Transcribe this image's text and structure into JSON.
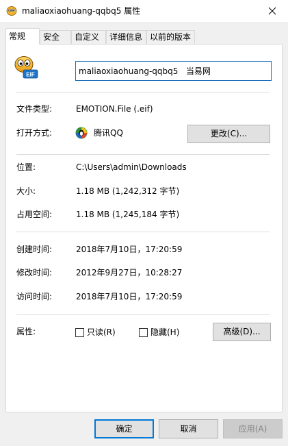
{
  "window": {
    "title": "maliaoxiaohuang-qqbq5 属性",
    "close_icon": "close-icon"
  },
  "tabs": [
    {
      "label": "常规",
      "active": true
    },
    {
      "label": "安全",
      "active": false
    },
    {
      "label": "自定义",
      "active": false
    },
    {
      "label": "详细信息",
      "active": false
    },
    {
      "label": "以前的版本",
      "active": false
    }
  ],
  "file": {
    "icon": "eif-file-icon",
    "icon_badge": "EIF",
    "name": "maliaoxiaohuang-qqbq5   当易网"
  },
  "type_section": {
    "file_type_label": "文件类型:",
    "file_type_value": "EMOTION.File (.eif)",
    "open_with_label": "打开方式:",
    "open_with_value": "腾讯QQ",
    "open_with_icon": "qq-penguin-icon",
    "change_button": "更改(C)..."
  },
  "location_section": {
    "location_label": "位置:",
    "location_value": "C:\\Users\\admin\\Downloads",
    "size_label": "大小:",
    "size_value": "1.18 MB (1,242,312 字节)",
    "size_on_disk_label": "占用空间:",
    "size_on_disk_value": "1.18 MB (1,245,184 字节)"
  },
  "time_section": {
    "created_label": "创建时间:",
    "created_value": "2018年7月10日，17:20:59",
    "modified_label": "修改时间:",
    "modified_value": "2012年9月27日，10:28:27",
    "accessed_label": "访问时间:",
    "accessed_value": "2018年7月10日，17:20:59"
  },
  "attributes": {
    "label": "属性:",
    "readonly_label": "只读(R)",
    "readonly_checked": false,
    "hidden_label": "隐藏(H)",
    "hidden_checked": false,
    "advanced_button": "高级(D)..."
  },
  "footer": {
    "ok_button": "确定",
    "cancel_button": "取消",
    "apply_button": "应用(A)"
  },
  "colors": {
    "accent": "#0078d7",
    "input_border": "#1f6fbf"
  }
}
